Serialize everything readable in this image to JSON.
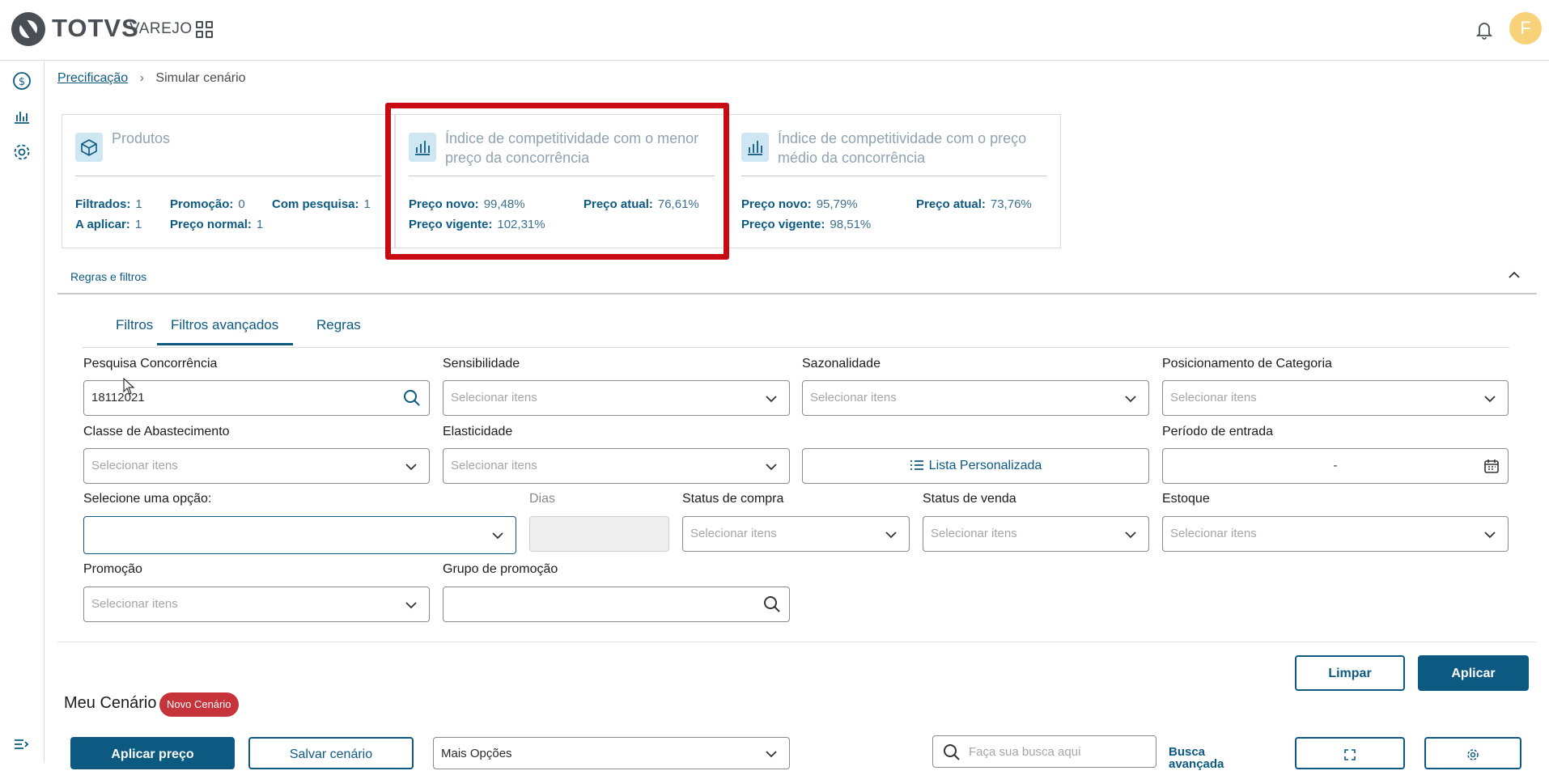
{
  "header": {
    "brand": "TOTVS",
    "brand_sub": "VAREJO",
    "avatar_initial": "F"
  },
  "breadcrumb": {
    "link": "Precificação",
    "current": "Simular cenário"
  },
  "cards": {
    "produtos": {
      "title": "Produtos",
      "filtrados_label": "Filtrados:",
      "filtrados_value": "1",
      "promocao_label": "Promoção:",
      "promocao_value": "0",
      "com_pesquisa_label": "Com pesquisa:",
      "com_pesquisa_value": "1",
      "a_aplicar_label": "A aplicar:",
      "a_aplicar_value": "1",
      "preco_normal_label": "Preço normal:",
      "preco_normal_value": "1"
    },
    "menor": {
      "title": "Índice de competitividade com o menor preço da concorrência",
      "preco_novo_label": "Preço novo:",
      "preco_novo_value": "99,48%",
      "preco_atual_label": "Preço atual:",
      "preco_atual_value": "76,61%",
      "preco_vigente_label": "Preço vigente:",
      "preco_vigente_value": "102,31%"
    },
    "medio": {
      "title": "Índice de competitividade com o preço médio da concorrência",
      "preco_novo_label": "Preço novo:",
      "preco_novo_value": "95,79%",
      "preco_atual_label": "Preço atual:",
      "preco_atual_value": "73,76%",
      "preco_vigente_label": "Preço vigente:",
      "preco_vigente_value": "98,51%"
    }
  },
  "rules": {
    "title": "Regras e filtros",
    "tabs": [
      "Filtros",
      "Filtros avançados",
      "Regras"
    ]
  },
  "filters": {
    "pesquisa_label": "Pesquisa Concorrência",
    "pesquisa_value": "18112021",
    "sensibilidade_label": "Sensibilidade",
    "sazonalidade_label": "Sazonalidade",
    "posicionamento_label": "Posicionamento de Categoria",
    "classe_label": "Classe de Abastecimento",
    "elasticidade_label": "Elasticidade",
    "lista_label": "Lista Personalizada",
    "periodo_label": "Período de entrada",
    "periodo_value": "-",
    "selecione_label": "Selecione uma opção:",
    "dias_label": "Dias",
    "status_compra_label": "Status de compra",
    "status_venda_label": "Status de venda",
    "estoque_label": "Estoque",
    "promocao_label": "Promoção",
    "grupo_label": "Grupo de promoção",
    "placeholder": "Selecionar itens"
  },
  "actions": {
    "limpar": "Limpar",
    "aplicar": "Aplicar"
  },
  "scenario": {
    "title": "Meu Cenário",
    "badge": "Novo Cenário",
    "aplicar_preco": "Aplicar preço",
    "salvar": "Salvar cenário",
    "mais_opcoes": "Mais Opções",
    "search_placeholder": "Faça sua busca aqui",
    "busca_avancada": "Busca avançada"
  },
  "colors": {
    "primary": "#0c5a82",
    "highlight": "#c80b13",
    "badge": "#c6333a"
  }
}
